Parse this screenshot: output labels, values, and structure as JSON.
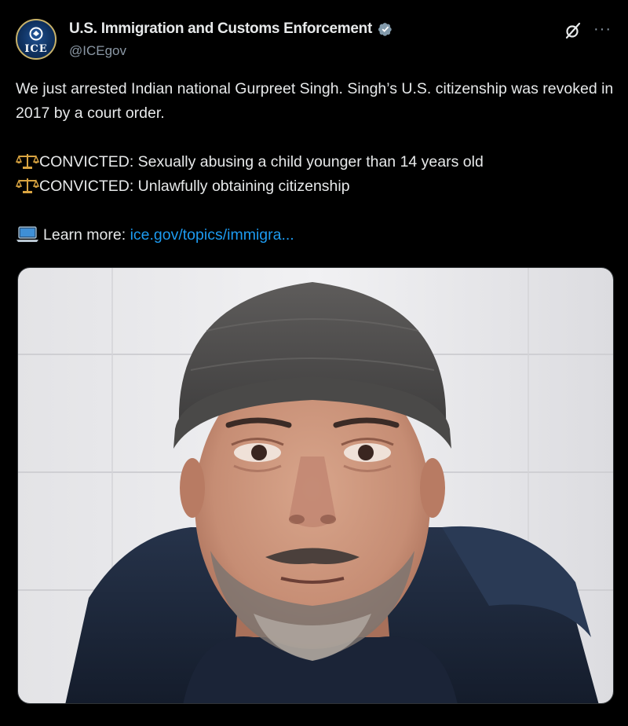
{
  "account": {
    "display_name": "U.S. Immigration and Customs Enforcement",
    "handle": "@ICEgov",
    "avatar_label": "ICE",
    "verified": true
  },
  "post": {
    "line1": "We just arrested Indian national Gurpreet Singh. Singh’s U.S. citizenship was revoked in 2017 by a court order.",
    "convicted_1": "CONVICTED: Sexually abusing a child younger than 14 years old",
    "convicted_2": "CONVICTED: Unlawfully obtaining citizenship",
    "learn_more_label": "Learn more:",
    "link_text": "ice.gov/topics/immigra..."
  },
  "icons": {
    "verified": "verified-badge-icon",
    "grok": "grok-icon",
    "more": "more-options-icon",
    "scale": "balance-scale-emoji",
    "laptop": "laptop-emoji"
  },
  "colors": {
    "background": "#000000",
    "text": "#e7e9ea",
    "secondary_text": "#8b98a5",
    "link": "#1d9bf0",
    "verified_badge": "#829aab"
  }
}
